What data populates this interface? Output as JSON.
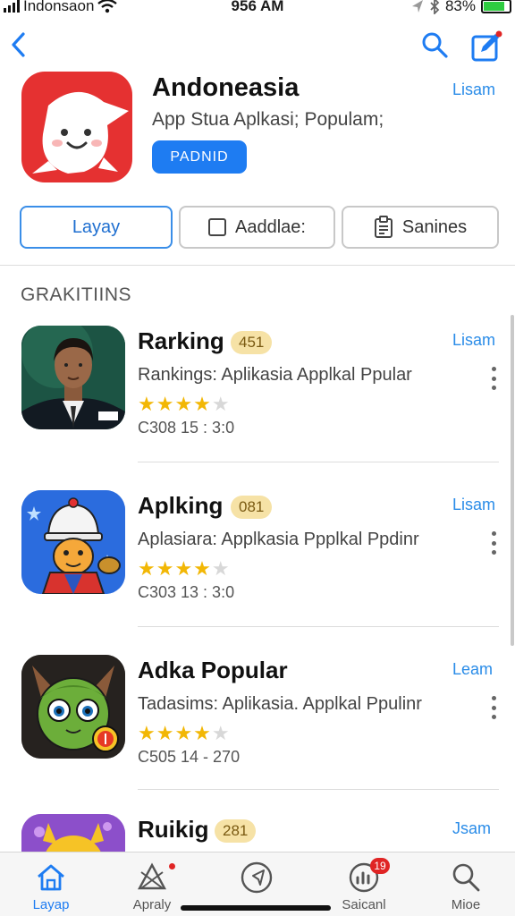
{
  "status_bar": {
    "carrier": "Indonsaon",
    "time": "956 AM",
    "battery": "83%",
    "battery_level": 0.83
  },
  "nav": {
    "back_icon": "chevron-left-icon",
    "search_icon": "search-icon",
    "edit_icon": "edit-icon"
  },
  "hero": {
    "title": "Andoneasia",
    "subtitle": "App Stua Aplkasi; Populam;",
    "button_label": "PADNID",
    "link": "Lisam"
  },
  "segments": [
    {
      "label": "Layay",
      "active": true
    },
    {
      "label": "Aaddlae:",
      "active": false
    },
    {
      "label": "Sanines",
      "active": false
    }
  ],
  "section": {
    "title": "GRAKITIINS"
  },
  "apps": [
    {
      "name": "Rarking",
      "badge": "451",
      "desc": "Rankings: Aplikasia Applkal Ppular",
      "rating": 3.5,
      "stars": "★★★★★",
      "meta": "C308 15 : 3:0",
      "link": "Lisam"
    },
    {
      "name": "Aplking",
      "badge": "081",
      "desc": "Aplasiara: Applkasia Ppplkal Ppdinr",
      "rating": 3.5,
      "stars": "★★★★★",
      "meta": "C303 13 : 3:0",
      "link": "Lisam"
    },
    {
      "name": "Adka Popular",
      "badge": "",
      "desc": "Tadasims: Aplikasia. Applkal Ppulinr",
      "rating": 3.5,
      "stars": "★★★★★",
      "meta": "C505 14 - 270",
      "link": "Leam"
    },
    {
      "name": "Ruikig",
      "badge": "281",
      "desc": "",
      "rating": 0,
      "stars": "",
      "meta": "",
      "link": "Jsam"
    }
  ],
  "tabs": [
    {
      "label": "Layap",
      "icon": "home-icon",
      "active": true
    },
    {
      "label": "Apraly",
      "icon": "apps-icon",
      "active": false
    },
    {
      "label": "",
      "icon": "navigation-icon",
      "active": false
    },
    {
      "label": "Saicanl",
      "icon": "chart-icon",
      "active": false,
      "badge": "19"
    },
    {
      "label": "Mioe",
      "icon": "search-icon",
      "active": false
    }
  ]
}
